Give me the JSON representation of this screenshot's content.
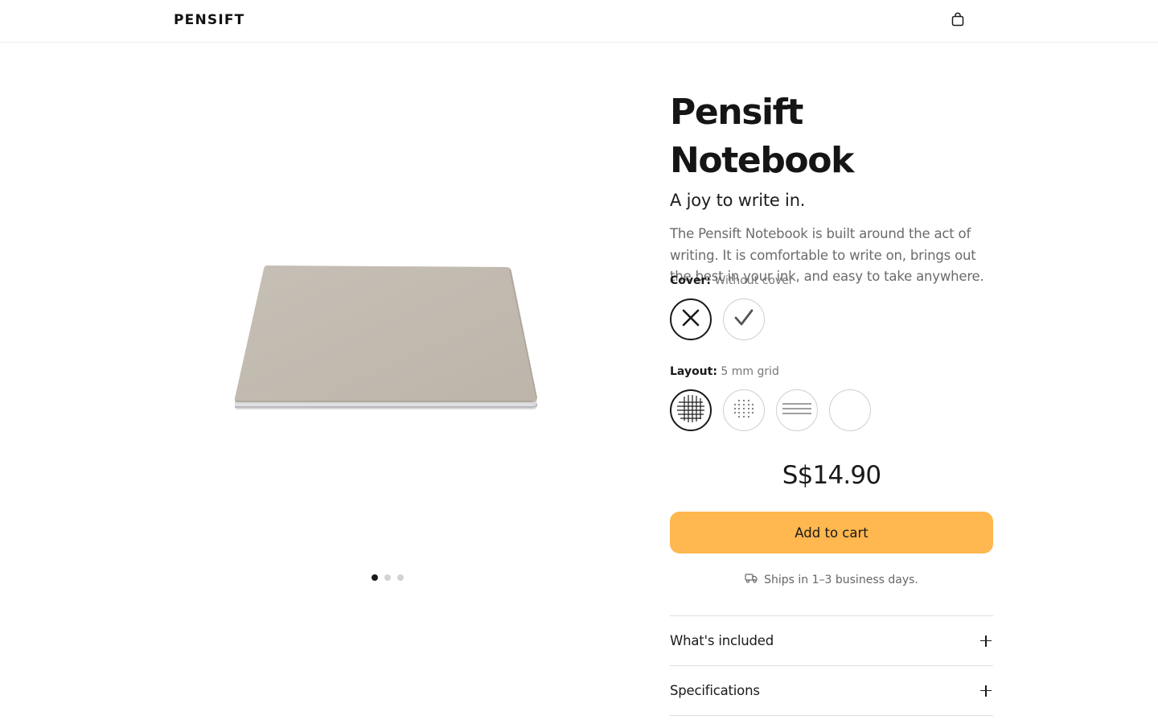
{
  "header": {
    "logo_text": "PENSIFT",
    "cart_icon": "shopping-bag-icon"
  },
  "gallery": {
    "image_name": "notebook-closed-image",
    "dots_count": 3,
    "active_dot": 1
  },
  "product": {
    "title": "Pensift Notebook",
    "tagline": "A joy to write in.",
    "description": "The Pensift Notebook is built around the act of writing. It is comfortable to write on, brings out the best in your ink, and easy to take anywhere.",
    "price": "S$14.90"
  },
  "cover": {
    "label": "Cover:",
    "value": "Without cover",
    "options": [
      {
        "name": "without-cover",
        "icon": "x-icon",
        "selected": true
      },
      {
        "name": "with-cover",
        "icon": "checkmark-icon",
        "selected": false
      }
    ]
  },
  "layout": {
    "label": "Layout:",
    "value": "5 mm grid",
    "options": [
      {
        "name": "grid",
        "icon": "grid-icon",
        "selected": true
      },
      {
        "name": "dotted",
        "icon": "dots-grid-icon",
        "selected": false
      },
      {
        "name": "lined",
        "icon": "lines-icon",
        "selected": false
      },
      {
        "name": "blank",
        "icon": "blank-icon",
        "selected": false
      }
    ]
  },
  "cta": {
    "add_to_cart": "Add to cart"
  },
  "shipping": {
    "icon": "truck-icon",
    "text": "Ships in 1–3 business days."
  },
  "accordion": {
    "items": [
      {
        "label": "What's included"
      },
      {
        "label": "Specifications"
      }
    ]
  },
  "colors": {
    "accent": "#ffb74f",
    "text": "#1a1a1a",
    "muted": "#6b6b6b",
    "border": "#dedede",
    "notebook_cover": "#c4bdb3"
  }
}
